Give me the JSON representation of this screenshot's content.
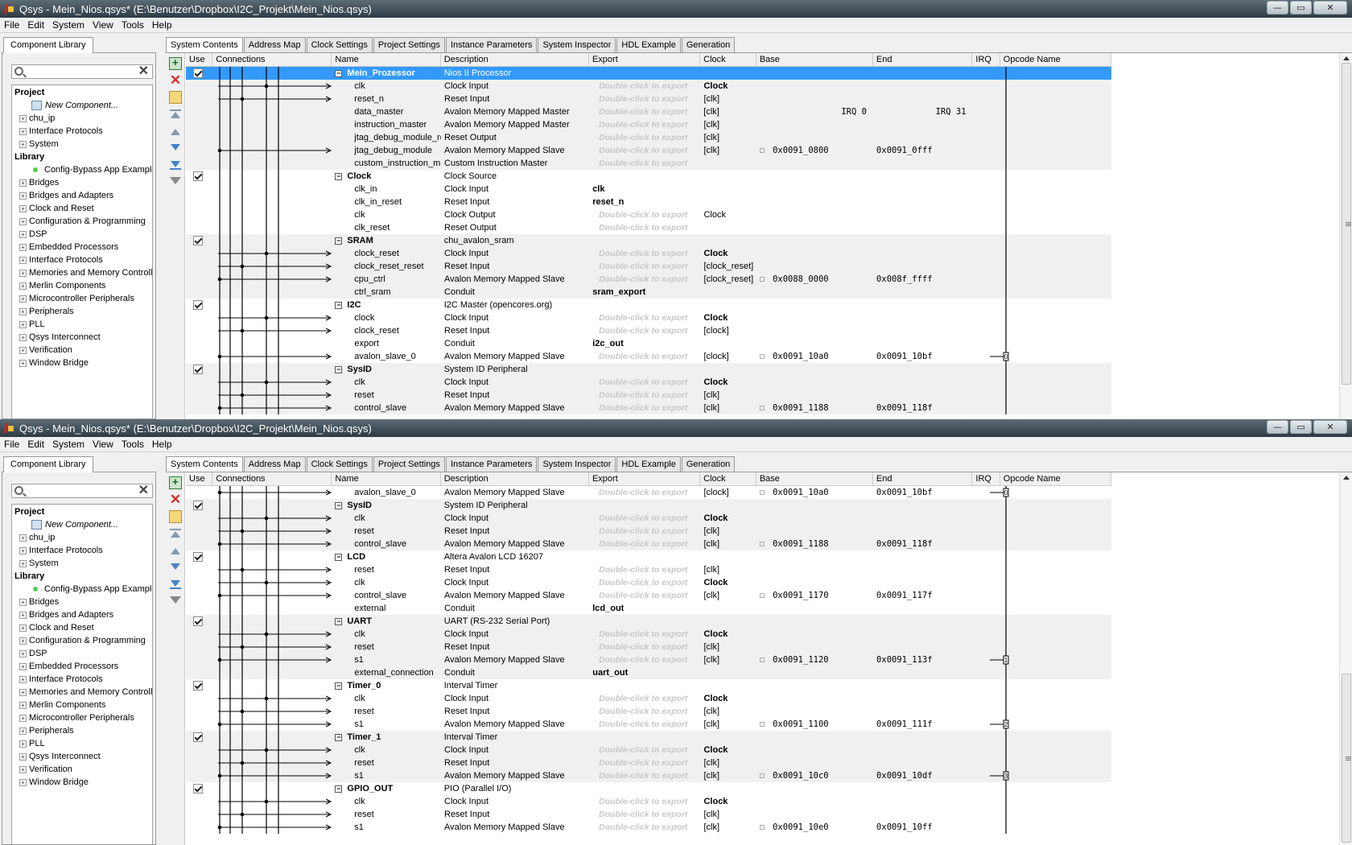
{
  "window": {
    "title": "Qsys - Mein_Nios.qsys* (E:\\Benutzer\\Dropbox\\I2C_Projekt\\Mein_Nios.qsys)",
    "buttons": {
      "minimize": "—",
      "maximize": "▭",
      "close": "✕"
    }
  },
  "menu": [
    "File",
    "Edit",
    "System",
    "View",
    "Tools",
    "Help"
  ],
  "library": {
    "tab": "Component Library",
    "search_placeholder": "",
    "clear": "✕",
    "project_header": "Project",
    "new_component": "New Component...",
    "project_items": [
      "chu_ip",
      "Interface Protocols",
      "System"
    ],
    "library_header": "Library",
    "config_bypass": "Config-Bypass App Example",
    "library_items": [
      "Bridges",
      "Bridges and Adapters",
      "Clock and Reset",
      "Configuration & Programming",
      "DSP",
      "Embedded Processors",
      "Interface Protocols",
      "Memories and Memory Controllers",
      "Merlin Components",
      "Microcontroller Peripherals",
      "Peripherals",
      "PLL",
      "Qsys Interconnect",
      "Verification",
      "Window Bridge"
    ]
  },
  "tabs": [
    "System Contents",
    "Address Map",
    "Clock Settings",
    "Project Settings",
    "Instance Parameters",
    "System Inspector",
    "HDL Example",
    "Generation"
  ],
  "columns": [
    "Use",
    "Connections",
    "Name",
    "Description",
    "Export",
    "Clock",
    "Base",
    "End",
    "IRQ",
    "Opcode Name"
  ],
  "export_hint": "Double-click to export",
  "top_irq_labels": {
    "left": "IRQ 0",
    "right": "IRQ 31"
  },
  "top_rows": [
    {
      "t": "c",
      "name": "Mein_Prozessor",
      "desc": "Nios II Processor",
      "sel": true
    },
    {
      "t": "p",
      "name": "clk",
      "desc": "Clock Input",
      "exp": "",
      "clk": "Clock",
      "clkb": true,
      "arr": true
    },
    {
      "t": "p",
      "name": "reset_n",
      "desc": "Reset Input",
      "exp": "",
      "clk": "[clk]",
      "arr": true
    },
    {
      "t": "p",
      "name": "data_master",
      "desc": "Avalon Memory Mapped Master",
      "exp": "",
      "clk": "[clk]",
      "irqL": true
    },
    {
      "t": "p",
      "name": "instruction_master",
      "desc": "Avalon Memory Mapped Master",
      "exp": "",
      "clk": "[clk]"
    },
    {
      "t": "p",
      "name": "jtag_debug_module_re...",
      "desc": "Reset Output",
      "exp": "",
      "clk": "[clk]"
    },
    {
      "t": "p",
      "name": "jtag_debug_module",
      "desc": "Avalon Memory Mapped Slave",
      "exp": "",
      "clk": "[clk]",
      "base": "0x0091_0800",
      "end": "0x0091_0fff",
      "arr": true
    },
    {
      "t": "p",
      "name": "custom_instruction_m...",
      "desc": "Custom Instruction Master",
      "exp": ""
    },
    {
      "t": "c",
      "name": "Clock",
      "desc": "Clock Source"
    },
    {
      "t": "p",
      "name": "clk_in",
      "desc": "Clock Input",
      "exp": "clk",
      "clk": ""
    },
    {
      "t": "p",
      "name": "clk_in_reset",
      "desc": "Reset Input",
      "exp": "reset_n",
      "clk": ""
    },
    {
      "t": "p",
      "name": "clk",
      "desc": "Clock Output",
      "exp": "",
      "clk": "Clock"
    },
    {
      "t": "p",
      "name": "clk_reset",
      "desc": "Reset Output",
      "exp": "",
      "clk": ""
    },
    {
      "t": "c",
      "name": "SRAM",
      "desc": "chu_avalon_sram"
    },
    {
      "t": "p",
      "name": "clock_reset",
      "desc": "Clock Input",
      "exp": "",
      "clk": "Clock",
      "clkb": true,
      "arr": true
    },
    {
      "t": "p",
      "name": "clock_reset_reset",
      "desc": "Reset Input",
      "exp": "",
      "clk": "[clock_reset]",
      "arr": true
    },
    {
      "t": "p",
      "name": "cpu_ctrl",
      "desc": "Avalon Memory Mapped Slave",
      "exp": "",
      "clk": "[clock_reset]",
      "base": "0x0088_0000",
      "end": "0x008f_ffff",
      "arr": true
    },
    {
      "t": "p",
      "name": "ctrl_sram",
      "desc": "Conduit",
      "exp": "sram_export",
      "clk": ""
    },
    {
      "t": "c",
      "name": "I2C",
      "desc": "I2C Master (opencores.org)"
    },
    {
      "t": "p",
      "name": "clock",
      "desc": "Clock Input",
      "exp": "",
      "clk": "Clock",
      "clkb": true,
      "arr": true
    },
    {
      "t": "p",
      "name": "clock_reset",
      "desc": "Reset Input",
      "exp": "",
      "clk": "[clock]",
      "arr": true
    },
    {
      "t": "p",
      "name": "export",
      "desc": "Conduit",
      "exp": "i2c_out",
      "clk": ""
    },
    {
      "t": "p",
      "name": "avalon_slave_0",
      "desc": "Avalon Memory Mapped Slave",
      "exp": "",
      "clk": "[clock]",
      "base": "0x0091_10a0",
      "end": "0x0091_10bf",
      "irq": "0",
      "arr": true
    },
    {
      "t": "c",
      "name": "SysID",
      "desc": "System ID Peripheral"
    },
    {
      "t": "p",
      "name": "clk",
      "desc": "Clock Input",
      "exp": "",
      "clk": "Clock",
      "clkb": true,
      "arr": true
    },
    {
      "t": "p",
      "name": "reset",
      "desc": "Reset Input",
      "exp": "",
      "clk": "[clk]",
      "arr": true
    },
    {
      "t": "p",
      "name": "control_slave",
      "desc": "Avalon Memory Mapped Slave",
      "exp": "",
      "clk": "[clk]",
      "base": "0x0091_1188",
      "end": "0x0091_118f",
      "arr": true
    }
  ],
  "bottom_rows": [
    {
      "t": "p",
      "name": "avalon_slave_0",
      "desc": "Avalon Memory Mapped Slave",
      "exp": "",
      "clk": "[clock]",
      "base": "0x0091_10a0",
      "end": "0x0091_10bf",
      "irq": "0",
      "arr": true
    },
    {
      "t": "c",
      "name": "SysID",
      "desc": "System ID Peripheral"
    },
    {
      "t": "p",
      "name": "clk",
      "desc": "Clock Input",
      "exp": "",
      "clk": "Clock",
      "clkb": true,
      "arr": true
    },
    {
      "t": "p",
      "name": "reset",
      "desc": "Reset Input",
      "exp": "",
      "clk": "[clk]",
      "arr": true
    },
    {
      "t": "p",
      "name": "control_slave",
      "desc": "Avalon Memory Mapped Slave",
      "exp": "",
      "clk": "[clk]",
      "base": "0x0091_1188",
      "end": "0x0091_118f",
      "arr": true
    },
    {
      "t": "c",
      "name": "LCD",
      "desc": "Altera Avalon LCD 16207"
    },
    {
      "t": "p",
      "name": "reset",
      "desc": "Reset Input",
      "exp": "",
      "clk": "[clk]",
      "arr": true
    },
    {
      "t": "p",
      "name": "clk",
      "desc": "Clock Input",
      "exp": "",
      "clk": "Clock",
      "clkb": true,
      "arr": true
    },
    {
      "t": "p",
      "name": "control_slave",
      "desc": "Avalon Memory Mapped Slave",
      "exp": "",
      "clk": "[clk]",
      "base": "0x0091_1170",
      "end": "0x0091_117f",
      "arr": true
    },
    {
      "t": "p",
      "name": "external",
      "desc": "Conduit",
      "exp": "lcd_out",
      "clk": ""
    },
    {
      "t": "c",
      "name": "UART",
      "desc": "UART (RS-232 Serial Port)"
    },
    {
      "t": "p",
      "name": "clk",
      "desc": "Clock Input",
      "exp": "",
      "clk": "Clock",
      "clkb": true,
      "arr": true
    },
    {
      "t": "p",
      "name": "reset",
      "desc": "Reset Input",
      "exp": "",
      "clk": "[clk]",
      "arr": true
    },
    {
      "t": "p",
      "name": "s1",
      "desc": "Avalon Memory Mapped Slave",
      "exp": "",
      "clk": "[clk]",
      "base": "0x0091_1120",
      "end": "0x0091_113f",
      "irq": "1",
      "arr": true
    },
    {
      "t": "p",
      "name": "external_connection",
      "desc": "Conduit",
      "exp": "uart_out",
      "clk": ""
    },
    {
      "t": "c",
      "name": "Timer_0",
      "desc": "Interval Timer"
    },
    {
      "t": "p",
      "name": "clk",
      "desc": "Clock Input",
      "exp": "",
      "clk": "Clock",
      "clkb": true,
      "arr": true
    },
    {
      "t": "p",
      "name": "reset",
      "desc": "Reset Input",
      "exp": "",
      "clk": "[clk]",
      "arr": true
    },
    {
      "t": "p",
      "name": "s1",
      "desc": "Avalon Memory Mapped Slave",
      "exp": "",
      "clk": "[clk]",
      "base": "0x0091_1100",
      "end": "0x0091_111f",
      "irq": "2",
      "arr": true
    },
    {
      "t": "c",
      "name": "Timer_1",
      "desc": "Interval Timer"
    },
    {
      "t": "p",
      "name": "clk",
      "desc": "Clock Input",
      "exp": "",
      "clk": "Clock",
      "clkb": true,
      "arr": true
    },
    {
      "t": "p",
      "name": "reset",
      "desc": "Reset Input",
      "exp": "",
      "clk": "[clk]",
      "arr": true
    },
    {
      "t": "p",
      "name": "s1",
      "desc": "Avalon Memory Mapped Slave",
      "exp": "",
      "clk": "[clk]",
      "base": "0x0091_10c0",
      "end": "0x0091_10df",
      "irq": "3",
      "arr": true
    },
    {
      "t": "c",
      "name": "GPIO_OUT",
      "desc": "PIO (Parallel I/O)"
    },
    {
      "t": "p",
      "name": "clk",
      "desc": "Clock Input",
      "exp": "",
      "clk": "Clock",
      "clkb": true,
      "arr": true
    },
    {
      "t": "p",
      "name": "reset",
      "desc": "Reset Input",
      "exp": "",
      "clk": "[clk]",
      "arr": true
    },
    {
      "t": "p",
      "name": "s1",
      "desc": "Avalon Memory Mapped Slave",
      "exp": "",
      "clk": "[clk]",
      "base": "0x0091_10e0",
      "end": "0x0091_10ff",
      "arr": true
    }
  ]
}
